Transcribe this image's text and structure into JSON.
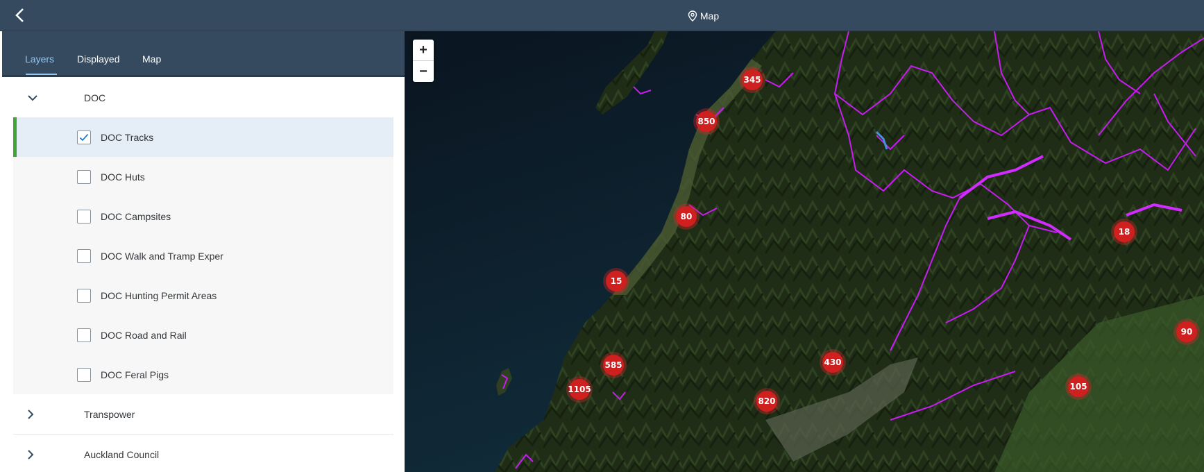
{
  "header": {
    "title": "Map",
    "back_icon": "chevron-left-icon",
    "title_icon": "map-pin-icon"
  },
  "tabs": [
    {
      "label": "Layers",
      "active": true
    },
    {
      "label": "Displayed",
      "active": false
    },
    {
      "label": "Map",
      "active": false
    }
  ],
  "layers": {
    "groups": [
      {
        "label": "DOC",
        "expanded": true,
        "items": [
          {
            "label": "DOC Tracks",
            "checked": true,
            "selected": true
          },
          {
            "label": "DOC Huts",
            "checked": false
          },
          {
            "label": "DOC Campsites",
            "checked": false
          },
          {
            "label": "DOC Walk and Tramp Exper",
            "checked": false
          },
          {
            "label": "DOC Hunting Permit Areas",
            "checked": false
          },
          {
            "label": "DOC Road and Rail",
            "checked": false
          },
          {
            "label": "DOC Feral Pigs",
            "checked": false
          }
        ]
      },
      {
        "label": "Transpower",
        "expanded": false
      },
      {
        "label": "Auckland Council",
        "expanded": false
      }
    ]
  },
  "map": {
    "zoom_in": "+",
    "zoom_out": "−",
    "clusters": [
      "345",
      "850",
      "80",
      "15",
      "585",
      "1105",
      "820",
      "430",
      "18",
      "90",
      "105"
    ]
  },
  "colors": {
    "accent": "#91c8f6",
    "selection_bar": "#3fa535",
    "cluster": "#cf1f1f",
    "tracks": "#c81cf2"
  }
}
